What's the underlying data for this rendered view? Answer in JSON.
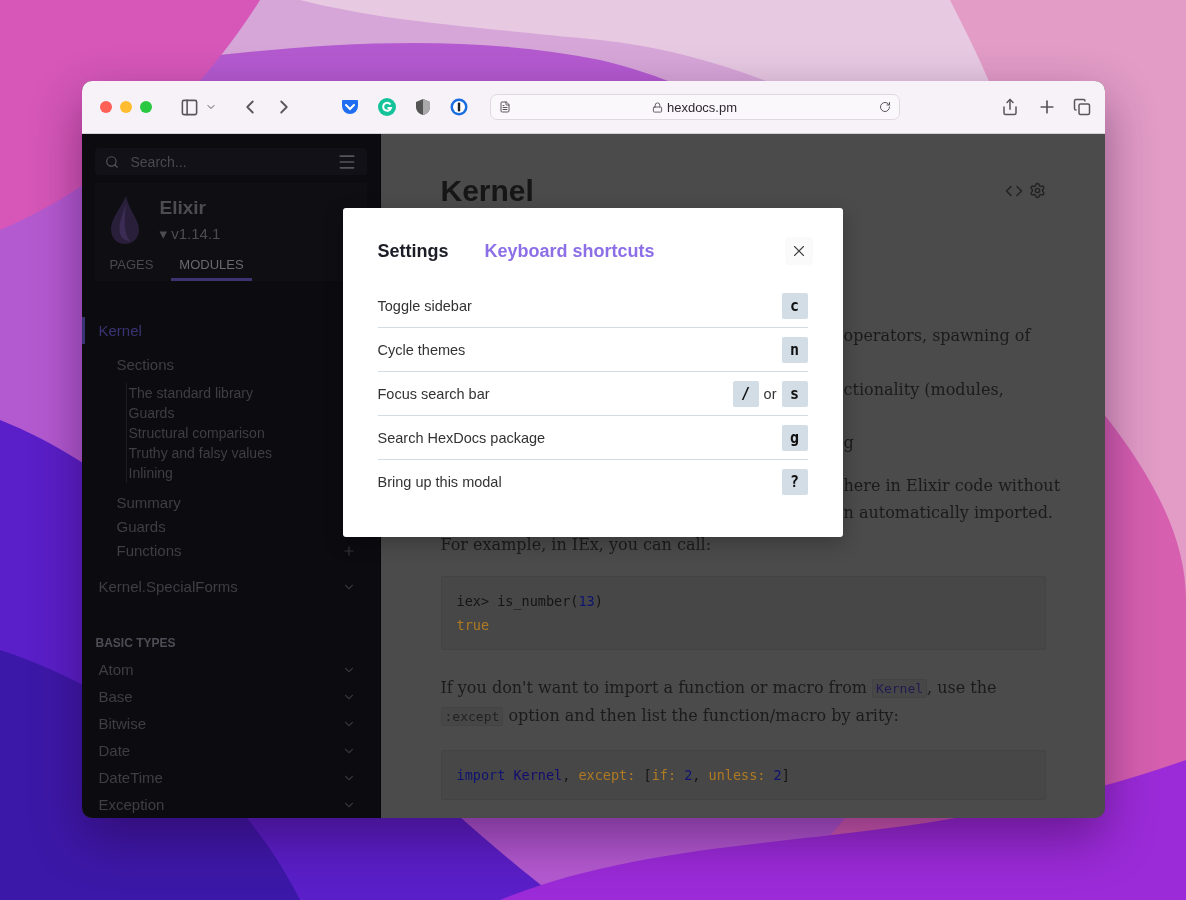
{
  "browser": {
    "url": "hexdocs.pm"
  },
  "sidebar": {
    "search_placeholder": "Search...",
    "project": "Elixir",
    "version": "▾ v1.14.1",
    "tabs": [
      {
        "label": "PAGES",
        "selected": false
      },
      {
        "label": "MODULES",
        "selected": true
      }
    ],
    "nav": [
      {
        "label": "Kernel",
        "selected": true,
        "children": [
          {
            "label": "Sections",
            "selected": false,
            "children": [
              {
                "label": "The standard library",
                "selected": false
              },
              {
                "label": "Guards",
                "selected": false
              },
              {
                "label": "Structural comparison",
                "selected": false
              },
              {
                "label": "Truthy and falsy values",
                "selected": false
              },
              {
                "label": "Inlining",
                "selected": false
              }
            ]
          },
          {
            "label": "Summary",
            "selected": false
          },
          {
            "label": "Guards",
            "selected": false
          },
          {
            "label": "Functions",
            "selected": false,
            "kind": "plus"
          }
        ]
      },
      {
        "label": "Kernel.SpecialForms",
        "selected": false,
        "kind": "chevron"
      }
    ],
    "groups": [
      {
        "title": "BASIC TYPES",
        "items": [
          {
            "label": "Atom",
            "kind": "chevron"
          },
          {
            "label": "Base",
            "kind": "chevron"
          },
          {
            "label": "Bitwise",
            "kind": "chevron"
          },
          {
            "label": "Date",
            "kind": "chevron"
          },
          {
            "label": "DateTime",
            "kind": "chevron"
          },
          {
            "label": "Exception",
            "kind": "chevron"
          }
        ]
      }
    ]
  },
  "content": {
    "title": "Kernel",
    "fragments": [
      "operators, spawning of",
      "ctionality (modules,",
      "g",
      "here in Elixir code without",
      "n automatically imported."
    ],
    "intro_line": "For example, in IEx, you can call:",
    "code_1": [
      [
        {
          "kind": "text",
          "text": "iex> is_number("
        },
        {
          "kind": "number",
          "text": "13"
        },
        {
          "kind": "text",
          "text": ")"
        }
      ],
      [
        {
          "kind": "atom",
          "text": "true"
        }
      ]
    ],
    "paragraph": [
      {
        "text": "If you don't want to import a function or macro from ",
        "code": false
      },
      {
        "text": "Kernel",
        "code": true
      },
      {
        "text": ", use the ",
        "code": false
      },
      {
        "text": ":except",
        "code": true
      },
      {
        "text": " option and then list the function/macro by arity:",
        "code": false
      }
    ],
    "code_2": [
      [
        {
          "kind": "keyword",
          "text": "import"
        },
        {
          "kind": "module",
          "text": " Kernel"
        },
        {
          "kind": "text",
          "text": ", "
        },
        {
          "kind": "atom",
          "text": "except:"
        },
        {
          "kind": "text",
          "text": " ["
        },
        {
          "kind": "atom",
          "text": "if:"
        },
        {
          "kind": "number",
          "text": " 2"
        },
        {
          "kind": "text",
          "text": ", "
        },
        {
          "kind": "atom",
          "text": "unless:"
        },
        {
          "kind": "number",
          "text": " 2"
        },
        {
          "kind": "text",
          "text": "]"
        }
      ]
    ]
  },
  "modal": {
    "tabs": [
      {
        "label": "Settings",
        "selected": false
      },
      {
        "label": "Keyboard shortcuts",
        "selected": true
      }
    ],
    "shortcuts": [
      {
        "action": "Toggle sidebar",
        "keys": [
          "c"
        ]
      },
      {
        "action": "Cycle themes",
        "keys": [
          "n"
        ]
      },
      {
        "action": "Focus search bar",
        "keys": [
          "/",
          "s"
        ],
        "separator": "or"
      },
      {
        "action": "Search HexDocs package",
        "keys": [
          "g"
        ]
      },
      {
        "action": "Bring up this modal",
        "keys": [
          "?"
        ]
      }
    ]
  }
}
